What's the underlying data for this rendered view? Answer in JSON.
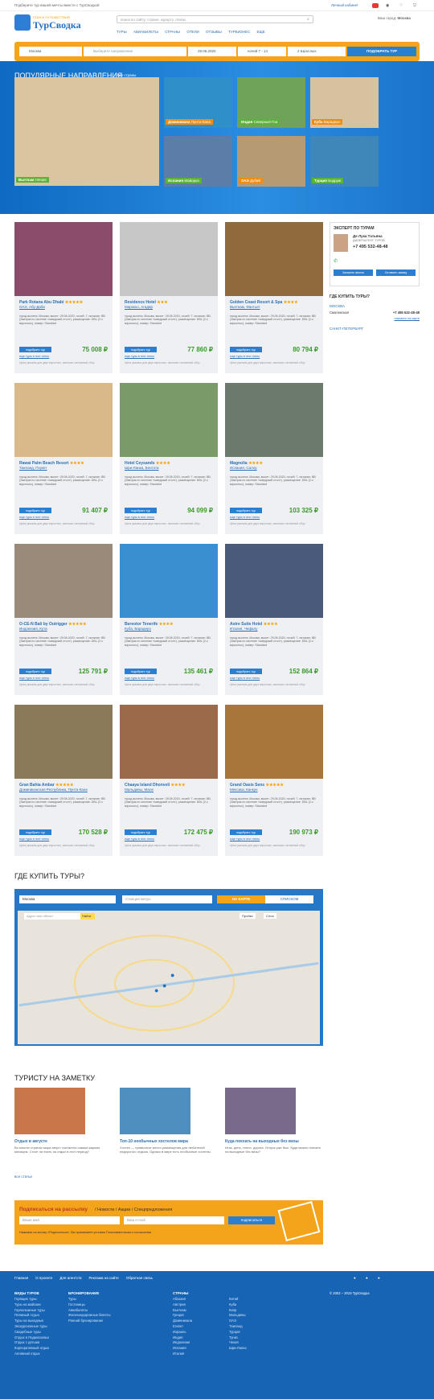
{
  "topbar": {
    "tagline": "Подберите тур вашей мечты вместе с ТурСводкой",
    "user": "Личный кабинет"
  },
  "logo": {
    "small": "ПОИСК ПУТЕШЕСТВИЙ",
    "big": "ТурСводка"
  },
  "search": {
    "placeholder": "поиск по сайту: стране, курорту, отелю"
  },
  "city": {
    "label": "Ваш город:",
    "value": "Москва"
  },
  "nav": [
    "ТУРЫ",
    "АВИАБИЛЕТЫ",
    "СТРАНЫ",
    "ОТЕЛИ",
    "ОТЗЫВЫ",
    "ТУРБИЗНЕС",
    "ЕЩЕ"
  ],
  "searchbar": {
    "from": "Москва",
    "to": "Выберите направление",
    "date": "29.06.2020",
    "nights": "ночей 7 - 14",
    "people": "2 взрослых",
    "button": "ПОДОБРАТЬ ТУР"
  },
  "hero": {
    "title": "ПОПУЛЯРНЫЕ НАПРАВЛЕНИЯ",
    "all": "все страны",
    "tiles": [
      {
        "c": "Вьетнам",
        "r": "Нячанг"
      },
      {
        "c": "Доминикана",
        "r": "Пунта-Кана"
      },
      {
        "c": "Индия",
        "r": "Северный Гоа"
      },
      {
        "c": "Куба",
        "r": "Варадеро"
      },
      {
        "c": "Испания",
        "r": "Майорка"
      },
      {
        "c": "ОАЭ",
        "r": "Дубай"
      },
      {
        "c": "Турция",
        "r": "Бодрум"
      }
    ]
  },
  "hotels": [
    {
      "name": "Park Rotana Abu Dhabi",
      "stars": "★★★★★",
      "loc": "ОАЭ, Абу-Даби",
      "price": "75 008 ₽"
    },
    {
      "name": "Residence Hotel",
      "stars": "★★★",
      "loc": "Марокко, Агадир",
      "price": "77 860 ₽"
    },
    {
      "name": "Golden Coast Resort & Spa",
      "stars": "★★★★",
      "loc": "Вьетнам, Фантьет",
      "price": "80 794 ₽"
    },
    {
      "name": "Rawai Palm Beach Resort",
      "stars": "★★★★",
      "loc": "Таиланд, Пхукет",
      "price": "91 407 ₽"
    },
    {
      "name": "Hotel Ceysands",
      "stars": "★★★★",
      "loc": "Шри-Ланка, Бентота",
      "price": "94 099 ₽"
    },
    {
      "name": "Magnolia",
      "stars": "★★★★",
      "loc": "Испания, Салоу",
      "price": "103 325 ₽"
    },
    {
      "name": "O-CE-N Bali by Outrigger",
      "stars": "★★★★★",
      "loc": "Индонезия, Кута",
      "price": "125 791 ₽"
    },
    {
      "name": "Bereotor Tenerife",
      "stars": "★★★★",
      "loc": "Куба, Варадеро",
      "price": "135 461 ₽"
    },
    {
      "name": "Astre Suite Hotel",
      "stars": "★★★★",
      "loc": "Италия, Чефалу",
      "price": "152 864 ₽"
    },
    {
      "name": "Gran Bahia Ambar",
      "stars": "★★★★★",
      "loc": "Доминиканская Республика, Пунта-Кана",
      "price": "170 528 ₽"
    },
    {
      "name": "Chaaya Island Dhonveli",
      "stars": "★★★★",
      "loc": "Мальдивы, Мале",
      "price": "172 475 ₽"
    },
    {
      "name": "Grand Oasis Sens",
      "stars": "★★★★★",
      "loc": "Мексика, Канкун",
      "price": "190 973 ₽"
    }
  ],
  "card": {
    "details": "город вылета: Москва, вылет: 29.06.2020, ночей: 7, питание: BB (Завтрак по системе «шведский стол»), размещение: DBL (2-х взрослых), номер: Standard",
    "button": "подобрать тур",
    "link": "еще туры в этот отель",
    "note": "Цена указана для двух взрослых, включая топливный сбор"
  },
  "expert": {
    "title": "ЭКСПЕРТ ПО ТУРАМ",
    "name": "Де Лука Татьяна",
    "role": "ДИЛЕР/АГЕНТ ТУРОВ",
    "phone": "+7 495 532-48-48",
    "b1": "Заказать звонок",
    "b2": "Оставить заявку"
  },
  "where": {
    "title": "ГДЕ КУПИТЬ ТУРЫ?",
    "city1": "МОСКВА",
    "agency": "Смоленская",
    "phone": "+7 495 532-48-48",
    "more": "показать на карте",
    "city2": "САНКТ-ПЕТЕРБУРГ"
  },
  "map": {
    "title": "ГДЕ КУПИТЬ ТУРЫ?",
    "city": "Москва",
    "metro": "Станция метро",
    "tab1": "НА КАРТЕ",
    "tab2": "СПИСКОМ",
    "addr": "Адрес или объект",
    "find": "Найти",
    "traffic": "Пробки",
    "layers": "Слои"
  },
  "notes": {
    "title": "ТУРИСТУ НА ЗАМЕТКУ",
    "all": "все статьи",
    "items": [
      {
        "t": "Отдых в августе",
        "d": "Во многих странах мира август считается самым жарким месяцем. Стоит ли ехать на отдых в этот период?"
      },
      {
        "t": "Топ-10 необычных хостелов мира",
        "d": "Хостел — привычное место размещения для любителей недорогого отдыха. Однако в мире есть необычные хостелы."
      },
      {
        "t": "Куда поехать на выходные без визы",
        "d": "Итак, день, тепло, дорога. Отпуск уже был. Куда можно поехать на выходные без визы?"
      }
    ]
  },
  "subscribe": {
    "title": "Подписаться на рассылку",
    "sub": "/ Новости / Акции / Спецпредложения",
    "name": "Ваше имя",
    "email": "Ваш e-mail",
    "btn": "подписаться",
    "agree": "Нажимая на кнопку «Подписаться», Вы принимаете условия Пользовательского соглашения"
  },
  "footer": {
    "links": [
      "Главная",
      "О проекте",
      "Для агентств",
      "Реклама на сайте",
      "Обратная связь"
    ],
    "col1h": "ВИДЫ ТУРОВ",
    "col1": [
      "Горящие туры",
      "Туры на майские",
      "Горнолыжные туры",
      "Пляжный отдых",
      "Туры на выходные",
      "Экскурсионные туры",
      "Свадебные туры",
      "Отдых в Подмосковье",
      "Отдых с детьми",
      "Корпоративный отдых",
      "Активный отдых"
    ],
    "col2h": "БРОНИРОВАНИЕ",
    "col2": [
      "Туры",
      "Гостиницы",
      "Авиабилеты",
      "Железнодорожные билеты",
      "Ранний бронирование"
    ],
    "col3h": "СТРАНЫ",
    "col3": [
      "Абхазия",
      "Австрия",
      "Вьетнам",
      "Греция",
      "Доминикана",
      "Египет",
      "Израиль",
      "Индия",
      "Индонезия",
      "Испания",
      "Италия"
    ],
    "col4": [
      "Китай",
      "Куба",
      "Кипр",
      "Мальдивы",
      "ОАЭ",
      "Таиланд",
      "Турция",
      "Тунис",
      "Чехия",
      "Шри-Ланка"
    ],
    "copy": "© 2002 – 2019 ТурСводка"
  }
}
